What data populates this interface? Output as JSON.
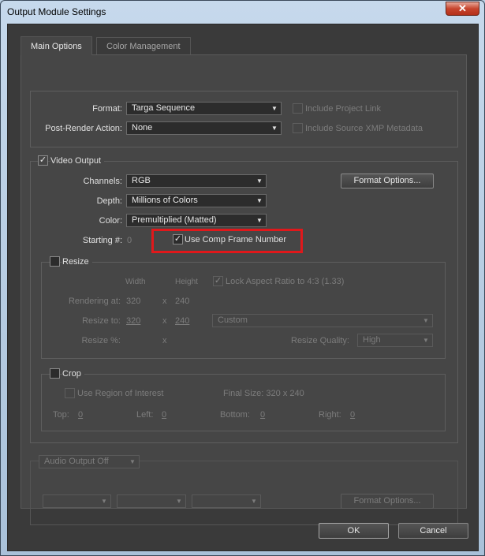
{
  "window": {
    "title": "Output Module Settings",
    "close_glyph": "✕"
  },
  "tabs": [
    {
      "label": "Main Options",
      "active": true
    },
    {
      "label": "Color Management",
      "active": false
    }
  ],
  "main": {
    "format_label": "Format:",
    "format_value": "Targa Sequence",
    "post_render_label": "Post-Render Action:",
    "post_render_value": "None",
    "include_project_link": "Include Project Link",
    "include_xmp": "Include Source XMP Metadata"
  },
  "video": {
    "heading": "Video Output",
    "checked": true,
    "channels_label": "Channels:",
    "channels_value": "RGB",
    "depth_label": "Depth:",
    "depth_value": "Millions of Colors",
    "color_label": "Color:",
    "color_value": "Premultiplied (Matted)",
    "starting_label": "Starting #:",
    "starting_value": "0",
    "use_comp_frame": "Use Comp Frame Number",
    "use_comp_frame_checked": true,
    "format_options": "Format Options...",
    "highlight_color": "#e0181b"
  },
  "resize": {
    "heading": "Resize",
    "width_header": "Width",
    "height_header": "Height",
    "lock_aspect": "Lock Aspect Ratio to 4:3 (1.33)",
    "rendering_at_label": "Rendering at:",
    "rendering_w": "320",
    "rendering_h": "240",
    "resize_to_label": "Resize to:",
    "resize_to_w": "320",
    "resize_to_h": "240",
    "resize_preset": "Custom",
    "resize_pct_label": "Resize %:",
    "x_glyph": "x",
    "quality_label": "Resize Quality:",
    "quality_value": "High"
  },
  "crop": {
    "heading": "Crop",
    "use_roi": "Use Region of Interest",
    "final_size": "Final Size: 320 x 240",
    "top_label": "Top:",
    "top_value": "0",
    "left_label": "Left:",
    "left_value": "0",
    "bottom_label": "Bottom:",
    "bottom_value": "0",
    "right_label": "Right:",
    "right_value": "0"
  },
  "audio": {
    "output_value": "Audio Output Off",
    "format_options": "Format Options..."
  },
  "footer": {
    "ok": "OK",
    "cancel": "Cancel"
  },
  "icons": {
    "dropdown": "▼",
    "check": "✓"
  }
}
